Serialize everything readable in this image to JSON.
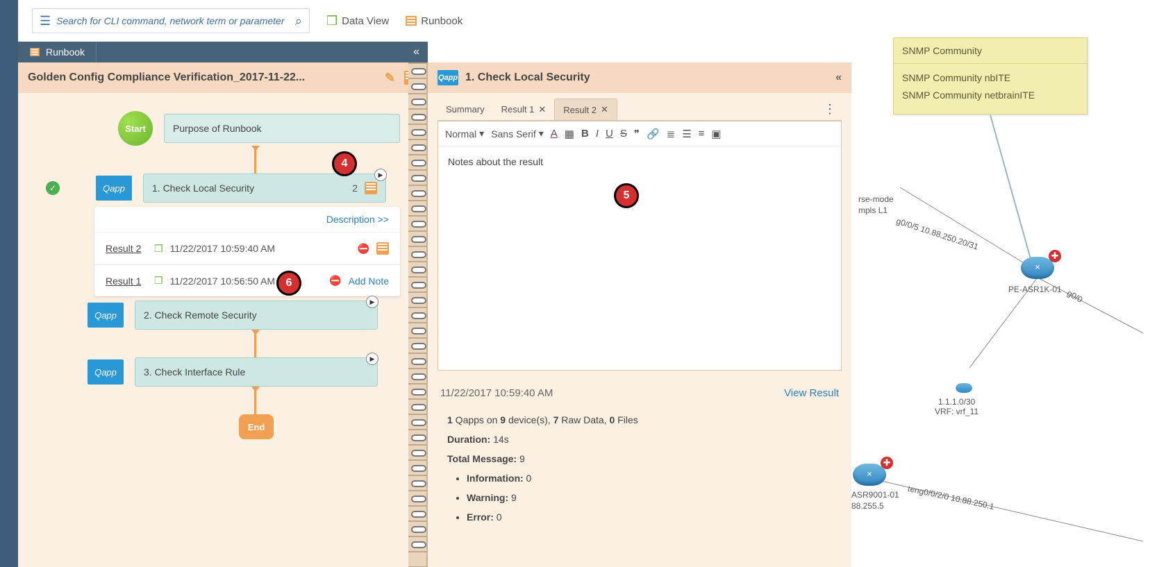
{
  "search": {
    "placeholder": "Search for CLI command, network term or parameter"
  },
  "top_buttons": {
    "data_view": "Data View",
    "runbook": "Runbook"
  },
  "tab": {
    "label": "Runbook"
  },
  "runbook": {
    "title": "Golden Config Compliance Verification_2017-11-22...",
    "start": "Start",
    "end": "End",
    "purpose": "Purpose of Runbook",
    "steps": [
      {
        "label": "1. Check Local Security",
        "count": "2"
      },
      {
        "label": "2. Check Remote Security"
      },
      {
        "label": "3. Check Interface Rule"
      }
    ],
    "description_link": "Description >>",
    "results": [
      {
        "name": "Result 2",
        "ts": "11/22/2017 10:59:40 AM",
        "alert": true,
        "note": true
      },
      {
        "name": "Result 1",
        "ts": "11/22/2017 10:56:50 AM",
        "alert": true,
        "addnote": "Add Note"
      }
    ],
    "qapp": "Qapp"
  },
  "detail": {
    "title": "1. Check Local Security",
    "tabs": {
      "summary": "Summary",
      "r1": "Result 1",
      "r2": "Result 2"
    },
    "editor": {
      "size": "Normal",
      "font": "Sans Serif",
      "text": "Notes about the result"
    },
    "summary": {
      "ts": "11/22/2017 10:59:40 AM",
      "view_result": "View Result",
      "line1_a": "1",
      "line1_b": " Qapps on ",
      "line1_c": "9",
      "line1_d": " device(s), ",
      "line1_e": "7",
      "line1_f": " Raw Data, ",
      "line1_g": "0",
      "line1_h": " Files",
      "dur_l": "Duration:",
      "dur_v": " 14s",
      "tot_l": "Total Message:",
      "tot_v": " 9",
      "info_l": "Information:",
      "info_v": " 0",
      "warn_l": "Warning:",
      "warn_v": " 9",
      "err_l": "Error:",
      "err_v": " 0"
    }
  },
  "map": {
    "sticky_title": "SNMP Community",
    "sticky_lines": [
      "SNMP Community nbITE",
      "SNMP Community netbrainITE"
    ],
    "dev1": "PE-ASR1K-01",
    "dev2": "ASR9001-01",
    "link1a": "rse-mode",
    "link1b": "mpls L1",
    "link2": "g0/0/5 10.88.250.20/31",
    "link3": "g0/0",
    "subnet": "1.1.1.0/30",
    "vrf": "VRF: vrf_11",
    "ip2": "88.255.5",
    "if2": "teng0/0/2/0 10.88.250.1"
  },
  "annotations": {
    "a4": "4",
    "a5": "5",
    "a6": "6"
  }
}
